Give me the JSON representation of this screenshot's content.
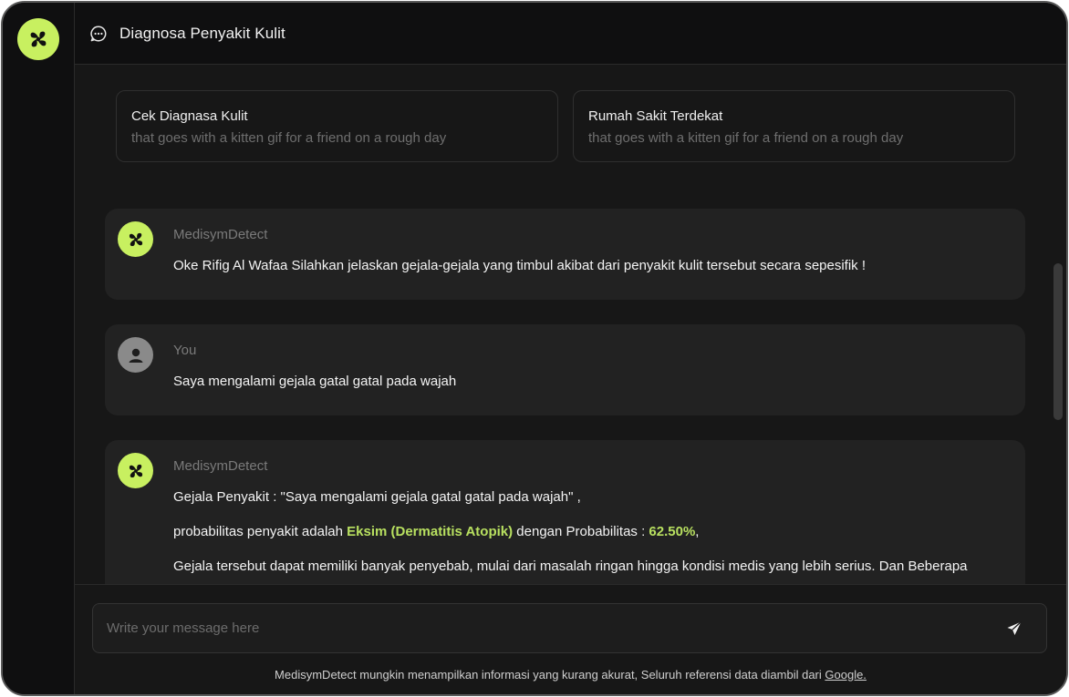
{
  "header": {
    "title": "Diagnosa Penyakit Kulit"
  },
  "suggestions": [
    {
      "title": "Cek Diagnasa Kulit",
      "subtitle": "that goes with a kitten gif for a friend on a rough day"
    },
    {
      "title": "Rumah Sakit Terdekat",
      "subtitle": "that goes with a kitten gif for a friend on a rough day"
    }
  ],
  "messages": [
    {
      "sender": "MedisymDetect",
      "text": "Oke Rifig Al Wafaa Silahkan jelaskan gejala-gejala yang timbul akibat dari penyakit kulit tersebut secara sepesifik !"
    },
    {
      "sender": "You",
      "text": "Saya mengalami gejala gatal gatal pada wajah"
    },
    {
      "sender": "MedisymDetect",
      "line1": "Gejala Penyakit : \"Saya mengalami gejala gatal gatal pada wajah\" ,",
      "line2_prefix": "probabilitas penyakit adalah ",
      "disease": "Eksim (Dermatitis Atopik)",
      "line2_mid": " dengan Probabilitas : ",
      "probability": "62.50%",
      "line2_suffix": ",",
      "line3": "Gejala tersebut dapat memiliki banyak penyebab, mulai dari masalah ringan hingga kondisi medis yang lebih serius. Dan Beberapa"
    }
  ],
  "composer": {
    "placeholder": "Write your message here"
  },
  "footer": {
    "text": "MedisymDetect mungkin menampilkan informasi yang kurang akurat, Seluruh referensi data diambil dari ",
    "link": "Google."
  },
  "icons": {
    "logo": "clover-logo-icon",
    "header": "chat-bubble-icon",
    "user_avatar": "user-avatar-icon",
    "send": "send-icon"
  },
  "colors": {
    "accent": "#c8f060",
    "highlight": "#b8e060",
    "background": "#171717",
    "card": "#222222"
  }
}
